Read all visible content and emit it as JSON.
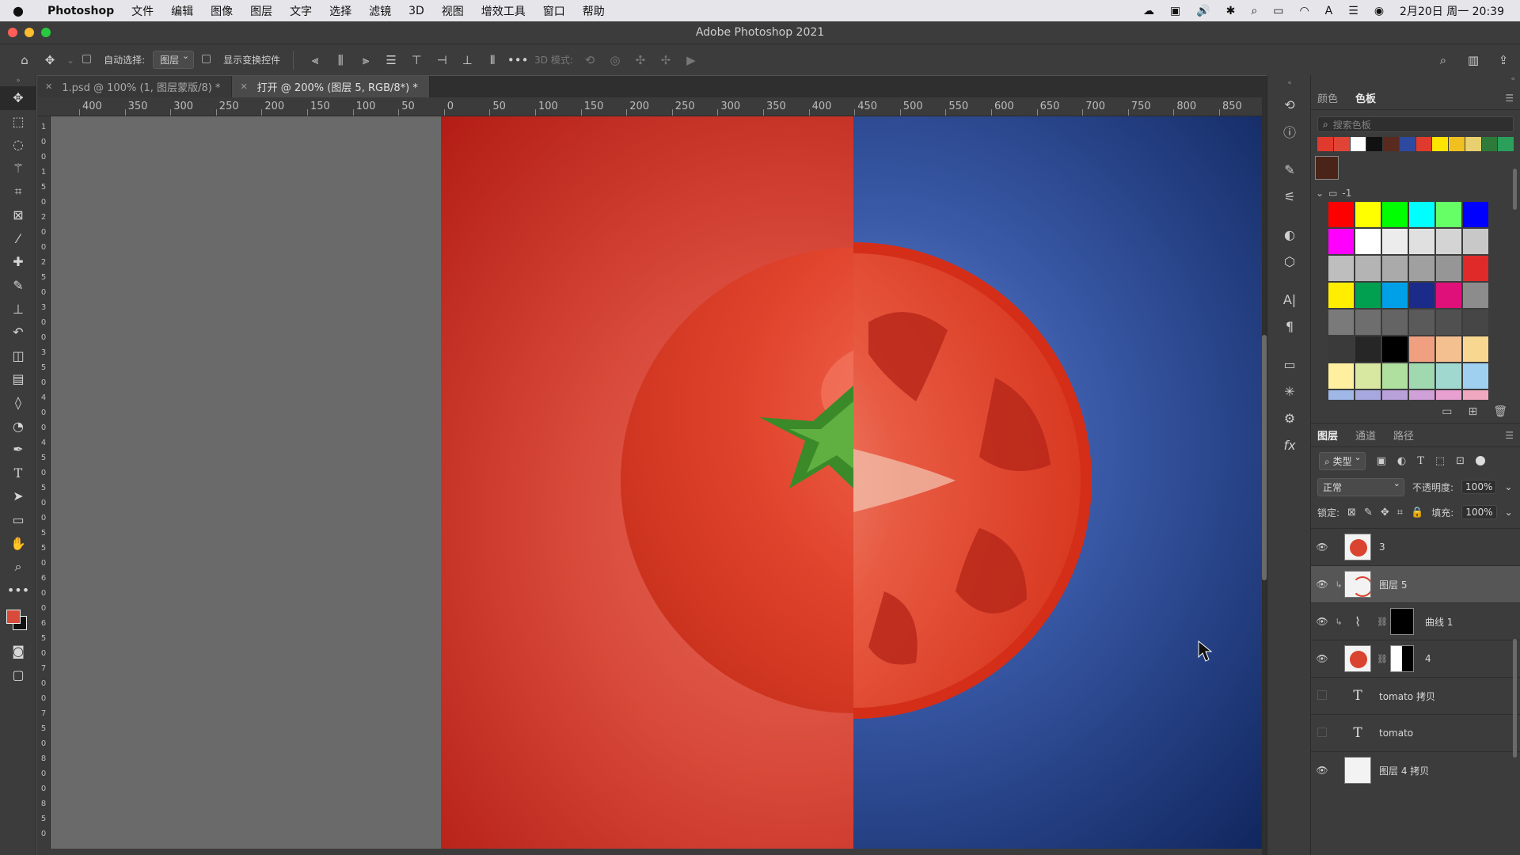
{
  "menubar": {
    "app": "Photoshop",
    "items": [
      "文件",
      "编辑",
      "图像",
      "图层",
      "文字",
      "选择",
      "滤镜",
      "3D",
      "视图",
      "增效工具",
      "窗口",
      "帮助"
    ],
    "datetime": "2月20日 周一 20:39"
  },
  "window": {
    "title": "Adobe Photoshop 2021"
  },
  "options": {
    "auto_select_label": "自动选择:",
    "auto_select_value": "图层",
    "show_transform_label": "显示变换控件",
    "mode_3d_label": "3D 模式:"
  },
  "tabs": [
    {
      "label": "1.psd @ 100% (1, 图层蒙版/8) *"
    },
    {
      "label": "打开 @ 200% (图层 5, RGB/8*) *"
    }
  ],
  "ruler_top": [
    "400",
    "350",
    "300",
    "250",
    "200",
    "150",
    "100",
    "50",
    "0",
    "50",
    "100",
    "150",
    "200",
    "250",
    "300",
    "350",
    "400",
    "450",
    "500",
    "550",
    "600",
    "650",
    "700",
    "750",
    "800",
    "850"
  ],
  "ruler_left": [
    "1",
    "0",
    "0",
    "1",
    "5",
    "0",
    "2",
    "0",
    "0",
    "2",
    "5",
    "0",
    "3",
    "0",
    "0",
    "3",
    "5",
    "0",
    "4",
    "0",
    "0",
    "4",
    "5",
    "0",
    "5",
    "0",
    "0",
    "5",
    "5",
    "0",
    "6",
    "0",
    "0",
    "6",
    "5",
    "0",
    "7",
    "0",
    "0",
    "7",
    "5",
    "0",
    "8",
    "0",
    "0",
    "8",
    "5",
    "0"
  ],
  "swatch_panel": {
    "tabs": [
      "颜色",
      "色板"
    ],
    "search_placeholder": "搜索色板",
    "recent_colors": [
      "#e03a2e",
      "#e04436",
      "#ffffff",
      "#111111",
      "#5a2a1e",
      "#2e4aa0",
      "#e03a2e",
      "#ffe400",
      "#f0c020",
      "#e8d070",
      "#2d7a3a",
      "#2aa05a"
    ],
    "current_color": "#4a2418",
    "folder_name": "-1",
    "grid_colors": [
      "#ff0000",
      "#ffff00",
      "#00ff00",
      "#00ffff",
      "#66ff66",
      "#0000ff",
      "#ff00ff",
      "#ffffff",
      "#ececec",
      "#e0e0e0",
      "#d4d4d4",
      "#c8c8c8",
      "#bebebe",
      "#b4b4b4",
      "#aaaaaa",
      "#a0a0a0",
      "#969696",
      "#e02a2a",
      "#ffee00",
      "#00a050",
      "#00a0e8",
      "#1c2a8a",
      "#e0107a",
      "#8c8c8c",
      "#7a7a7a",
      "#6e6e6e",
      "#646464",
      "#5a5a5a",
      "#505050",
      "#464646",
      "#3a3a3a",
      "#262626",
      "#000000",
      "#f0a080",
      "#f5c090",
      "#f8d890",
      "#fff0a0",
      "#d8e8a0",
      "#b0e0a0",
      "#a0d8b0",
      "#a0d8d0",
      "#a0d0f0",
      "#a0b8e8",
      "#a8a8e0",
      "#b8a0d8",
      "#d0a0d8",
      "#e8a0d0",
      "#f0a8c0",
      "#f0a090",
      "#f0a070",
      "#f0b060",
      "#f8d060",
      "#f0e060",
      "#c8e060"
    ]
  },
  "layers_panel": {
    "tabs": [
      "图层",
      "通道",
      "路径"
    ],
    "filter_label": "类型",
    "blend_mode": "正常",
    "opacity_label": "不透明度:",
    "opacity_value": "100%",
    "lock_label": "锁定:",
    "fill_label": "填充:",
    "fill_value": "100%",
    "layers": [
      {
        "name": "3"
      },
      {
        "name": "图层 5"
      },
      {
        "name": "曲线 1"
      },
      {
        "name": "4"
      },
      {
        "name": "tomato 拷贝"
      },
      {
        "name": "tomato"
      },
      {
        "name": "图层 4 拷贝"
      }
    ]
  }
}
